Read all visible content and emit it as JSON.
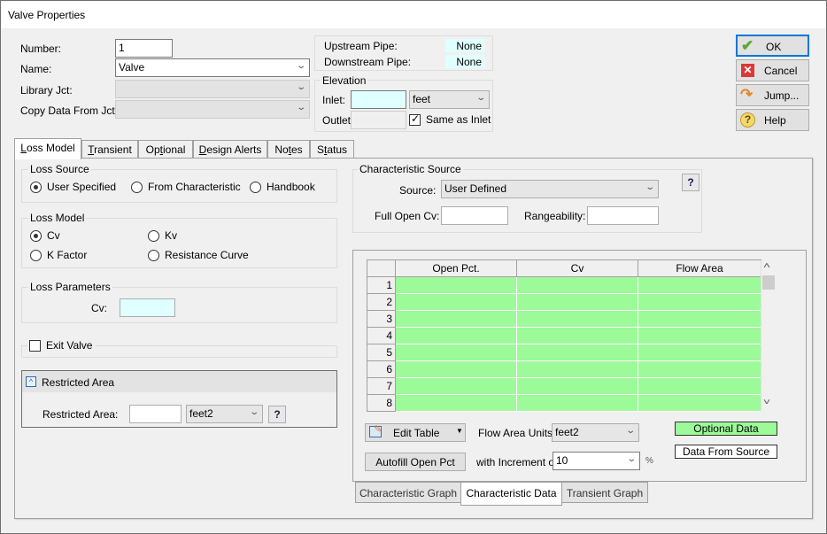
{
  "window": {
    "title": "Valve Properties"
  },
  "header": {
    "number_label": "Number:",
    "number_value": "1",
    "name_label": "Name:",
    "name_value": "Valve",
    "library_label": "Library Jct:",
    "library_value": "",
    "copy_label": "Copy Data From Jct...",
    "copy_value": ""
  },
  "pipes": {
    "upstream_label": "Upstream Pipe:",
    "upstream_value": "None",
    "downstream_label": "Downstream Pipe:",
    "downstream_value": "None"
  },
  "elevation": {
    "title": "Elevation",
    "inlet_label": "Inlet:",
    "inlet_value": "",
    "unit": "feet",
    "outlet_label": "Outlet:",
    "outlet_value": "",
    "same_as_inlet_label": "Same as Inlet",
    "same_as_inlet_checked": true
  },
  "actions": {
    "ok": "OK",
    "cancel": "Cancel",
    "jump": "Jump...",
    "help": "Help"
  },
  "tabs": [
    {
      "label": "Loss Model",
      "underline": "L",
      "rest": "oss Model",
      "active": true
    },
    {
      "label": "Transient",
      "underline": "T",
      "rest": "ransient"
    },
    {
      "label": "Optional",
      "pre": "Op",
      "underline": "t",
      "rest": "ional"
    },
    {
      "label": "Design Alerts",
      "underline": "D",
      "rest": "esign Alerts"
    },
    {
      "label": "Notes",
      "pre": "No",
      "underline": "t",
      "rest": "es"
    },
    {
      "label": "Status",
      "pre": "S",
      "underline": "t",
      "rest": "atus"
    }
  ],
  "loss_source": {
    "title": "Loss Source",
    "options": [
      "User Specified",
      "From Characteristic",
      "Handbook"
    ],
    "selected": "User Specified"
  },
  "loss_model": {
    "title": "Loss Model",
    "options": [
      "Cv",
      "Kv",
      "K Factor",
      "Resistance Curve"
    ],
    "selected": "Cv"
  },
  "loss_parameters": {
    "title": "Loss Parameters",
    "cv_label": "Cv:",
    "cv_value": ""
  },
  "exit_valve": {
    "label": "Exit Valve",
    "checked": false
  },
  "restricted_area": {
    "title": "Restricted Area",
    "label": "Restricted Area:",
    "value": "",
    "unit": "feet2",
    "help": "?"
  },
  "characteristic_source": {
    "title": "Characteristic Source",
    "source_label": "Source:",
    "source_value": "User Defined",
    "full_open_label": "Full Open Cv:",
    "full_open_value": "",
    "rangeability_label": "Rangeability:",
    "rangeability_value": "",
    "help": "?"
  },
  "table": {
    "columns": [
      "Open Pct.",
      "Cv",
      "Flow Area"
    ],
    "rows": [
      {
        "n": "1",
        "cells": [
          "",
          "",
          ""
        ]
      },
      {
        "n": "2",
        "cells": [
          "",
          "",
          ""
        ]
      },
      {
        "n": "3",
        "cells": [
          "",
          "",
          ""
        ]
      },
      {
        "n": "4",
        "cells": [
          "",
          "",
          ""
        ]
      },
      {
        "n": "5",
        "cells": [
          "",
          "",
          ""
        ]
      },
      {
        "n": "6",
        "cells": [
          "",
          "",
          ""
        ]
      },
      {
        "n": "7",
        "cells": [
          "",
          "",
          ""
        ]
      },
      {
        "n": "8",
        "cells": [
          "",
          "",
          ""
        ]
      }
    ],
    "cell_color": "#9cfa99"
  },
  "table_controls": {
    "edit_table": "Edit Table",
    "flow_area_units_label": "Flow Area Units:",
    "flow_area_units_value": "feet2",
    "autofill": "Autofill Open Pct",
    "increment_label": "with Increment of",
    "increment_value": "10",
    "percent": "%",
    "legend_optional": "Optional Data",
    "legend_source": "Data From Source"
  },
  "bottom_tabs": [
    {
      "label": "Characteristic Graph"
    },
    {
      "label": "Characteristic Data",
      "active": true
    },
    {
      "label": "Transient Graph"
    }
  ]
}
